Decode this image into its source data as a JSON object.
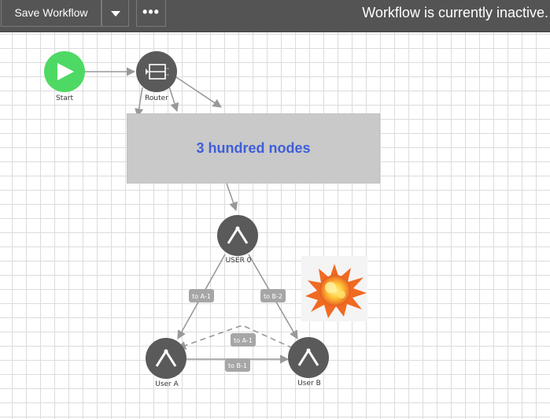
{
  "toolbar": {
    "save_label": "Save Workflow",
    "dropdown_icon": "caret-down-icon",
    "more_label": "•••",
    "status": "Workflow is currently inactive."
  },
  "canvas": {
    "block_label": "3 hundred nodes",
    "nodes": {
      "start": "Start",
      "router": "Router",
      "user0": "USER 0",
      "user_a": "User A",
      "user_b": "User B"
    },
    "edges": {
      "to_a1_left": "to A-1",
      "to_b2": "to B-2",
      "to_a1_mid": "to A-1",
      "to_b1": "to B-1"
    },
    "sticker_icon": "explosion-icon"
  },
  "colors": {
    "toolbar_bg": "#545454",
    "start_node": "#4ed964",
    "node": "#5a5a5a",
    "block_bg": "#c9c9c9",
    "block_text": "#3e5ed8",
    "edge": "#999999",
    "badge": "#a6a6a6"
  }
}
